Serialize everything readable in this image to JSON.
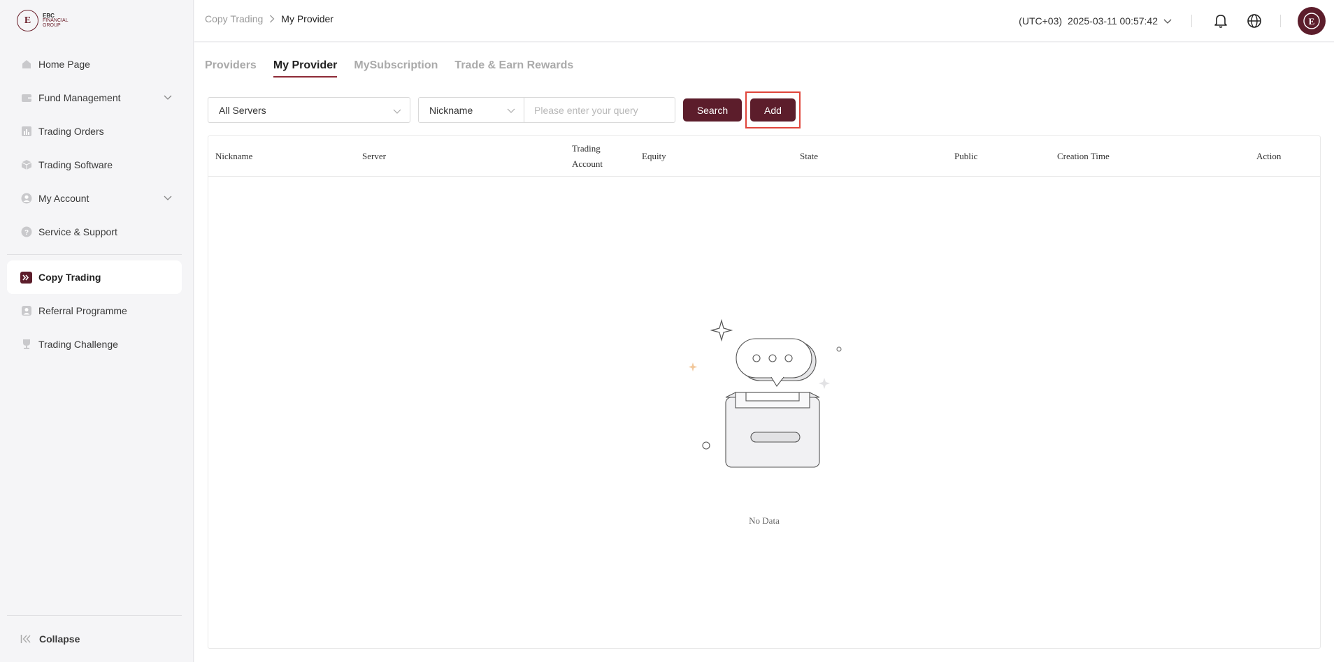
{
  "brand": {
    "logo_line1": "EBC",
    "logo_line2": "FINANCIAL",
    "logo_line3": "GROUP"
  },
  "sidebar": {
    "items": [
      {
        "label": "Home Page",
        "icon": "home-icon",
        "expandable": false
      },
      {
        "label": "Fund Management",
        "icon": "wallet-icon",
        "expandable": true
      },
      {
        "label": "Trading Orders",
        "icon": "chart-bars-icon",
        "expandable": false
      },
      {
        "label": "Trading Software",
        "icon": "box-icon",
        "expandable": false
      },
      {
        "label": "My Account",
        "icon": "user-icon",
        "expandable": true
      },
      {
        "label": "Service & Support",
        "icon": "help-icon",
        "expandable": false
      },
      {
        "label": "Copy Trading",
        "icon": "copy-trading-icon",
        "expandable": false,
        "active": true
      },
      {
        "label": "Referral Programme",
        "icon": "referral-icon",
        "expandable": false
      },
      {
        "label": "Trading Challenge",
        "icon": "trophy-icon",
        "expandable": false
      }
    ],
    "collapse_label": "Collapse"
  },
  "header": {
    "breadcrumb": [
      "Copy Trading",
      "My Provider"
    ],
    "timezone": "(UTC+03)",
    "datetime": "2025-03-11 00:57:42"
  },
  "tabs": [
    {
      "label": "Providers",
      "active": false
    },
    {
      "label": "My Provider",
      "active": true
    },
    {
      "label": "MySubscription",
      "active": false
    },
    {
      "label": "Trade & Earn Rewards",
      "active": false
    }
  ],
  "filters": {
    "server_select": "All Servers",
    "field_select": "Nickname",
    "query_placeholder": "Please enter your query",
    "query_value": "",
    "search_label": "Search",
    "add_label": "Add"
  },
  "table": {
    "columns": [
      "Nickname",
      "Server",
      "Trading Account",
      "Equity",
      "State",
      "Public",
      "Creation Time",
      "Action"
    ],
    "rows": [],
    "empty_text": "No Data"
  },
  "colors": {
    "accent": "#5c1d2b",
    "tab_underline": "#8e2a37",
    "highlight": "#e0453b"
  }
}
